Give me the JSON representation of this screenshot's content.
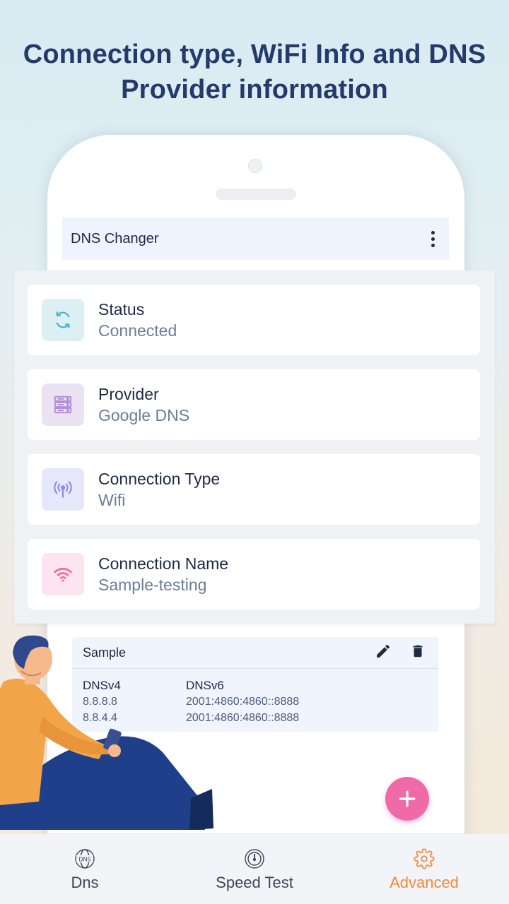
{
  "headline": {
    "line1": "Connection type, WiFi Info and DNS",
    "line2": "Provider information"
  },
  "appbar": {
    "title": "DNS Changer",
    "menu_icon": "more-vert-icon"
  },
  "info_cards": [
    {
      "label": "Status",
      "value": "Connected",
      "icon": "sync-icon",
      "icon_bg": "#dcf0f4",
      "icon_color": "#4fb3c7"
    },
    {
      "label": "Provider",
      "value": "Google DNS",
      "icon": "server-icon",
      "icon_bg": "#ebe3f3",
      "icon_color": "#b08fd2"
    },
    {
      "label": "Connection Type",
      "value": "Wifi",
      "icon": "antenna-icon",
      "icon_bg": "#e5e7fa",
      "icon_color": "#8a8fe0"
    },
    {
      "label": "Connection Name",
      "value": "Sample-testing",
      "icon": "wifi-icon",
      "icon_bg": "#fde4ee",
      "icon_color": "#ef6aa3"
    }
  ],
  "dns_entry": {
    "name": "Sample",
    "v4_header": "DNSv4",
    "v6_header": "DNSv6",
    "v4_primary": "8.8.8.8",
    "v4_secondary": "8.8.4.4",
    "v6_primary": "2001:4860:4860::8888",
    "v6_secondary": "2001:4860:4860::8888"
  },
  "fab": {
    "icon": "plus-icon",
    "color": "#f06aa7"
  },
  "bottom_nav": [
    {
      "label": "Dns",
      "icon": "dns-globe-icon",
      "active": false
    },
    {
      "label": "Speed Test",
      "icon": "speedometer-icon",
      "active": false
    },
    {
      "label": "Advanced",
      "icon": "gear-icon",
      "active": true
    }
  ],
  "colors": {
    "accent": "#f0883a",
    "headline": "#243a6b",
    "text": "#1d2a44"
  }
}
